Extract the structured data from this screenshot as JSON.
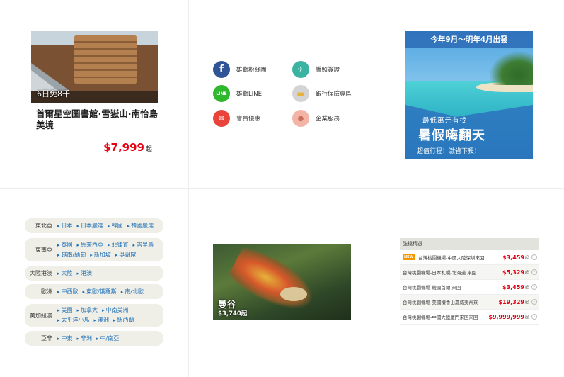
{
  "featured_tour": {
    "badge": "6日免8千",
    "title": "首爾星空圖書館·雪嶽山·南怡島美境",
    "price": "$7,999",
    "price_unit": "起"
  },
  "services": [
    {
      "label": "雄獅粉絲團",
      "icon": "facebook-icon",
      "color": "#3b5998",
      "glyph": "f"
    },
    {
      "label": "護照簽證",
      "icon": "passport-icon",
      "color": "#3bb3a2",
      "glyph": "✈"
    },
    {
      "label": "雄獅LINE",
      "icon": "line-icon",
      "color": "#2db82d",
      "glyph": "LINE"
    },
    {
      "label": "銀行保險專區",
      "icon": "credit-card-icon",
      "color": "#c9c9c9",
      "glyph": "▬"
    },
    {
      "label": "會員優惠",
      "icon": "coupon-icon",
      "color": "#e9443a",
      "glyph": "✉"
    },
    {
      "label": "企業服務",
      "icon": "business-person-icon",
      "color": "#f3a89a",
      "glyph": "●"
    }
  ],
  "promo_banner": {
    "top": "今年9月～明年4月出發",
    "line1": "最低萬元有找",
    "headline": "暑假嗨翻天",
    "line3": "超值行程！激省下殺！"
  },
  "regions": [
    {
      "label": "東北亞",
      "links": [
        "日本",
        "日本嚴選",
        "韓國",
        "韓國嚴選"
      ]
    },
    {
      "label": "東南亞",
      "links": [
        "泰國",
        "馬來西亞",
        "菲律賓",
        "峇里島",
        "越南/緬甸",
        "新加坡",
        "吳哥窟"
      ]
    },
    {
      "label": "大陸港澳",
      "links": [
        "大陸",
        "港澳"
      ]
    },
    {
      "label": "歐洲",
      "links": [
        "中西歐",
        "東歐/俄羅斯",
        "南/北歐"
      ]
    },
    {
      "label": "美加紐澳",
      "links": [
        "美國",
        "加拿大",
        "中南美洲",
        "太平洋小島",
        "澳洲",
        "紐西蘭"
      ]
    },
    {
      "label": "亞非",
      "links": [
        "中東",
        "非洲",
        "中/南亞"
      ]
    }
  ],
  "city_card": {
    "name": "曼谷",
    "price": "$3,740起"
  },
  "deals": {
    "header": "強檔精選",
    "new_tag": "NEW",
    "price_unit": "起",
    "arrow": "›",
    "rows": [
      {
        "route": "台灣桃園機場-中國大陸深圳來回",
        "price": "$3,459",
        "is_new": true
      },
      {
        "route": "台灣桃園機場-日本札幌-北海道 來回",
        "price": "$5,329",
        "is_new": false
      },
      {
        "route": "台灣桃園機場-韓國首爾 來回",
        "price": "$3,459",
        "is_new": false
      },
      {
        "route": "台灣桃園機場-美國檀香山夏威夷州來",
        "price": "$19,329",
        "is_new": false
      },
      {
        "route": "台灣桃園機場-中國大陸廈門來回來回",
        "price": "$9,999,999",
        "is_new": false
      }
    ]
  }
}
